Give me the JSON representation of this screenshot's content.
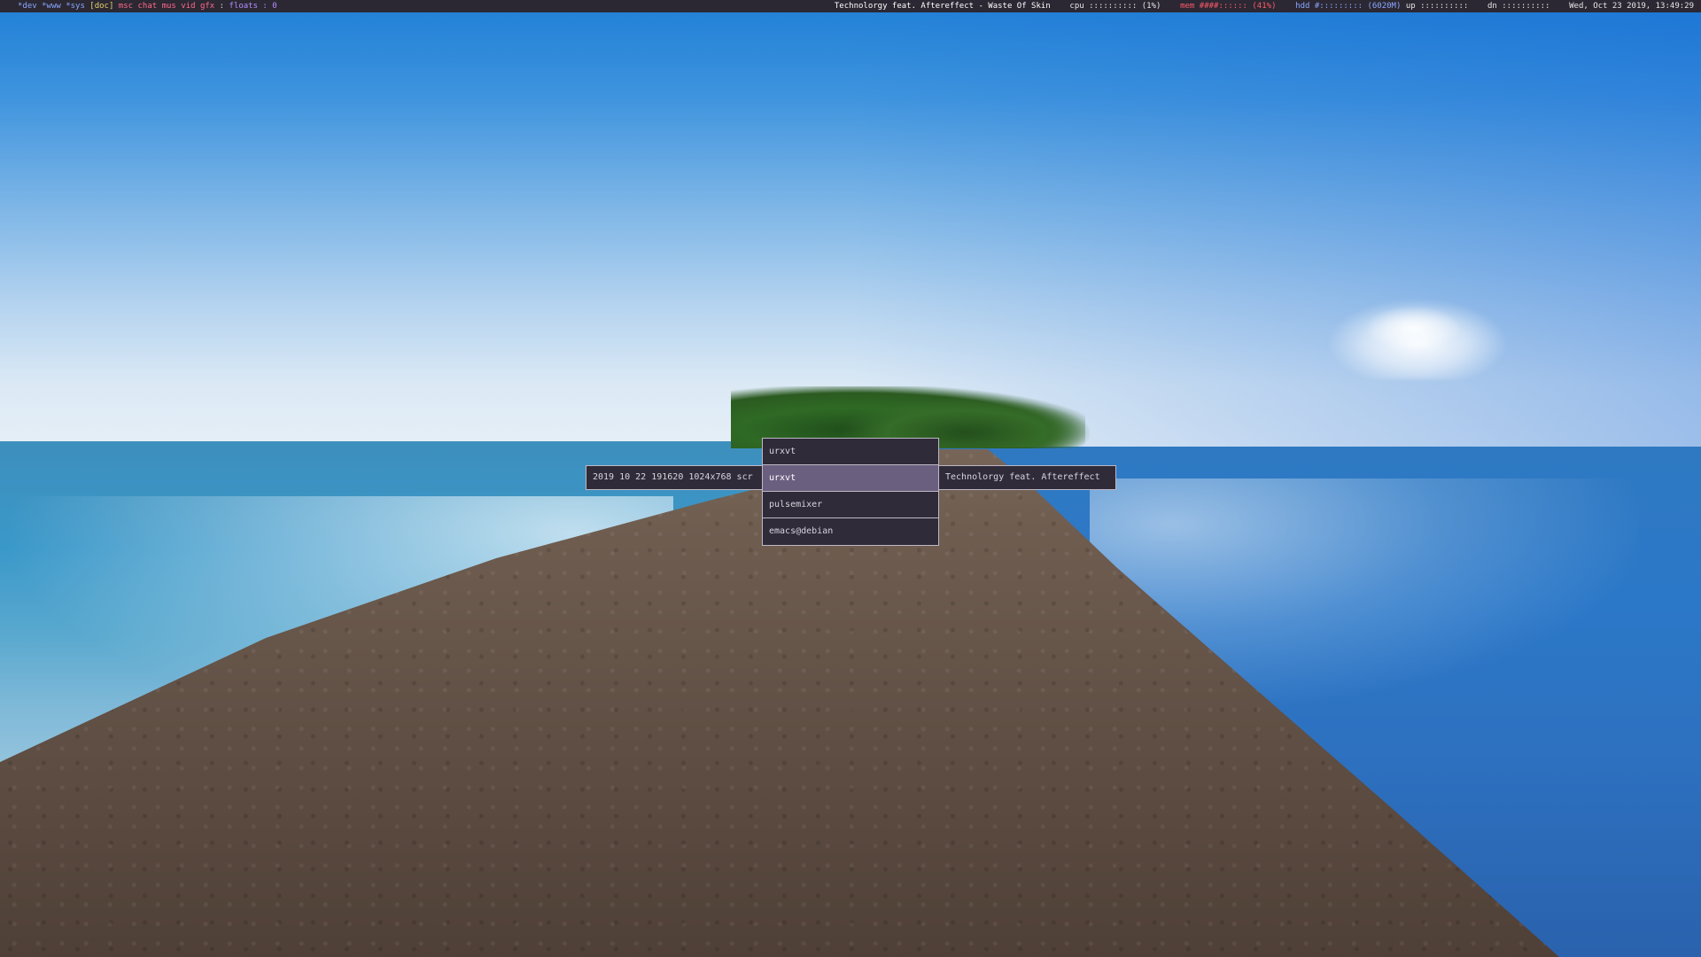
{
  "statusbar": {
    "workspaces": [
      {
        "label": "*dev",
        "color": "#8aa7ff"
      },
      {
        "label": " *www",
        "color": "#8aa7ff"
      },
      {
        "label": " *sys",
        "color": "#8aa7ff"
      },
      {
        "label": " [doc]",
        "color": "#e6d36b"
      },
      {
        "label": " msc",
        "color": "#ff6a8a"
      },
      {
        "label": " chat",
        "color": "#ff6a8a"
      },
      {
        "label": " mus",
        "color": "#ff6a8a"
      },
      {
        "label": " vid",
        "color": "#ff6a8a"
      },
      {
        "label": " gfx",
        "color": "#ff6a8a"
      }
    ],
    "separator": " : ",
    "floats_label": "floats",
    "floats_sep": " : ",
    "floats_count": "0",
    "now_playing": "Technolorgy feat. Aftereffect - Waste Of Skin",
    "cpu_label": "cpu",
    "cpu_graph": "::::::::::",
    "cpu_value": "(1%)",
    "mem_label": "mem",
    "mem_graph": "####::::::",
    "mem_value": "(41%)",
    "hdd_label": "hdd",
    "hdd_graph": "#:::::::::",
    "hdd_value": "(6020M)",
    "up_label": "up",
    "up_graph": "::::::::::",
    "dn_label": "dn",
    "dn_graph": "::::::::::",
    "datetime": "Wed, Oct 23 2019, 13:49:29",
    "colors": {
      "background": "#2b2833",
      "workspace_active": "#8aa7ff",
      "workspace_current": "#e6d36b",
      "workspace_other": "#ff6a8a",
      "floats": "#b58cff",
      "now_playing": "#ffffff",
      "cpu": "#e6e6e6",
      "mem": "#ff5a6a",
      "hdd": "#8aa7ff"
    }
  },
  "launcher": {
    "left_info": "2019 10 22 191620 1024x768 scr",
    "right_info": "Technolorgy feat. Aftereffect",
    "items": [
      {
        "label": "urxvt",
        "selected": false
      },
      {
        "label": "urxvt",
        "selected": true
      },
      {
        "label": "pulsemixer",
        "selected": false
      },
      {
        "label": "emacs@debian",
        "selected": false
      }
    ],
    "colors": {
      "background": "#2f2b38",
      "selected": "#6b5f80",
      "border": "#bdb8c6",
      "text": "#d8d5de"
    }
  }
}
